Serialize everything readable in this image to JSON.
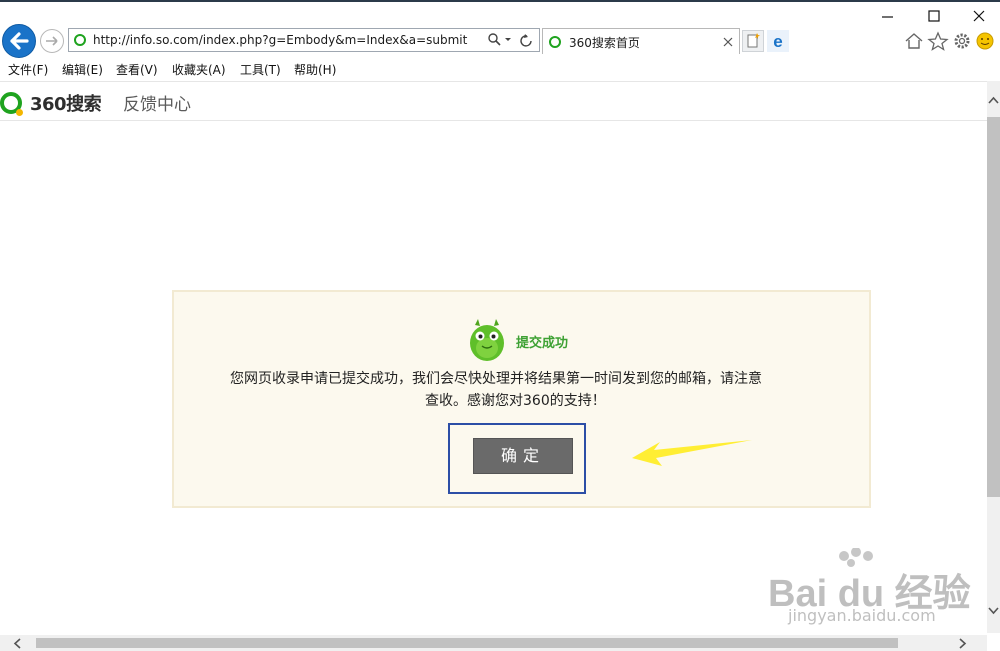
{
  "browser": {
    "url": "http://info.so.com/index.php?g=Embody&m=Index&a=submit",
    "tab_title": "360搜索首页",
    "menu": [
      "文件(F)",
      "编辑(E)",
      "查看(V)",
      "收藏夹(A)",
      "工具(T)",
      "帮助(H)"
    ]
  },
  "page": {
    "logo_text": "360搜索",
    "header_title": "反馈中心",
    "notice": {
      "title": "提交成功",
      "message_line1": "您网页收录申请已提交成功，我们会尽快处理并将结果第一时间发到您的邮箱，请注意",
      "message_line2": "查收。感谢您对360的支持！",
      "confirm_label": "确定"
    }
  },
  "watermark": {
    "brand": "Bai du 经验",
    "url": "jingyan.baidu.com"
  },
  "colors": {
    "accent_green": "#3da133",
    "frame_blue": "#2c4ea6",
    "arrow_yellow": "#ffee33",
    "back_button": "#1a73c8"
  }
}
